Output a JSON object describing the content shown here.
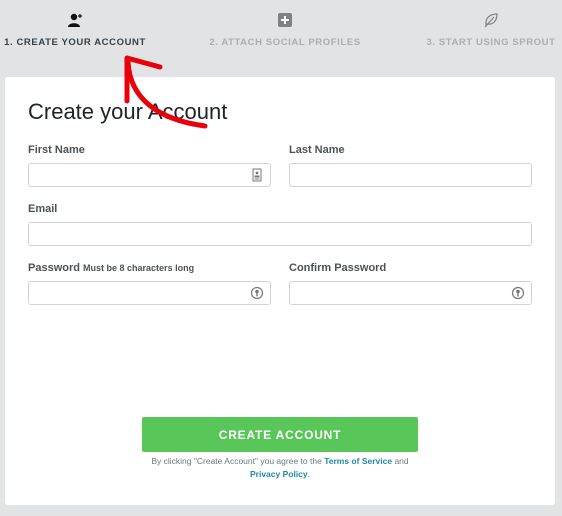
{
  "steps": [
    {
      "number": "1.",
      "label": "1. CREATE YOUR ACCOUNT",
      "icon": "add-user-icon",
      "state": "active"
    },
    {
      "number": "2.",
      "label": "2. ATTACH SOCIAL PROFILES",
      "icon": "plus-square-icon",
      "state": "inactive"
    },
    {
      "number": "3.",
      "label": "3. START USING SPROUT",
      "icon": "leaf-icon",
      "state": "inactive"
    }
  ],
  "form": {
    "title": "Create your Account",
    "first_name": {
      "label": "First Name",
      "value": "",
      "icon": "contact-card-icon"
    },
    "last_name": {
      "label": "Last Name",
      "value": ""
    },
    "email": {
      "label": "Email",
      "value": ""
    },
    "password": {
      "label": "Password",
      "hint": "Must be 8 characters long",
      "value": "",
      "icon": "password-key-icon"
    },
    "confirm_password": {
      "label": "Confirm Password",
      "value": "",
      "icon": "password-key-icon"
    },
    "submit_label": "CREATE ACCOUNT",
    "terms_prefix": "By clicking \"Create Account\" you agree to the",
    "terms_link": "Terms of Service",
    "terms_and": "and",
    "privacy_link": "Privacy Policy",
    "terms_suffix": "."
  },
  "colors": {
    "accent_green": "#59c659",
    "link_blue": "#1d8aa8",
    "annotation_red": "#e8000b"
  },
  "annotation": {
    "type": "arrow",
    "points_to": "1. CREATE YOUR ACCOUNT"
  }
}
